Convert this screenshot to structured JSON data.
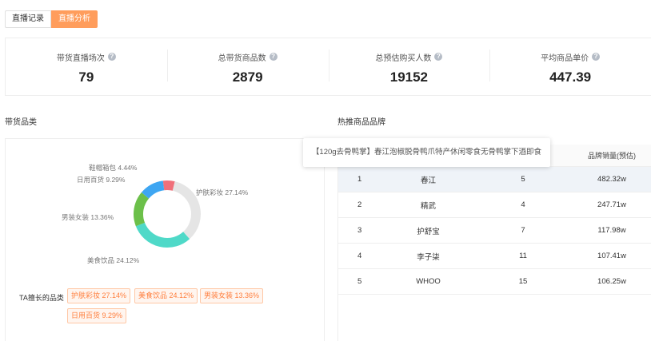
{
  "tabs": [
    {
      "label": "直播记录",
      "active": false
    },
    {
      "label": "直播分析",
      "active": true
    }
  ],
  "stats": [
    {
      "label": "带货直播场次",
      "value": "79"
    },
    {
      "label": "总带货商品数",
      "value": "2879"
    },
    {
      "label": "总预估购买人数",
      "value": "19152"
    },
    {
      "label": "平均商品单价",
      "value": "447.39"
    }
  ],
  "category_section": {
    "title": "带货品类"
  },
  "brand_section": {
    "title": "热推商品品牌"
  },
  "chart_data": {
    "type": "pie",
    "donut": true,
    "title": "",
    "slices": [
      {
        "label": "护肤彩妆 27.14%",
        "value": 27.14,
        "color": "#e5e5e5"
      },
      {
        "label": "美食饮品 24.12%",
        "value": 24.12,
        "color": "#4fd9c8"
      },
      {
        "label": "男装女装 13.36%",
        "value": 13.36,
        "color": "#6cc04a"
      },
      {
        "label": "日用百货 9.29%",
        "value": 9.29,
        "color": "#3ea6f2"
      },
      {
        "label": "鞋帽箱包 4.44%",
        "value": 4.44,
        "color": "#f0707a"
      }
    ]
  },
  "ta": {
    "title": "TA擅长的品类",
    "tags": [
      "护肤彩妆 27.14%",
      "美食饮品 24.12%",
      "男装女装 13.36%",
      "日用百货 9.29%"
    ]
  },
  "tooltip": "【120g去骨鸭掌】春江泡椒脱骨鸭爪特产休闲零食无骨鸭掌下酒即食",
  "brand_table": {
    "header_sales": "品牌销量(预估)",
    "rows": [
      {
        "rank": "1",
        "brand": "春江",
        "count": "5",
        "sales": "482.32w"
      },
      {
        "rank": "2",
        "brand": "精武",
        "count": "4",
        "sales": "247.71w"
      },
      {
        "rank": "3",
        "brand": "护舒宝",
        "count": "7",
        "sales": "117.98w"
      },
      {
        "rank": "4",
        "brand": "李子柒",
        "count": "11",
        "sales": "107.41w"
      },
      {
        "rank": "5",
        "brand": "WHOO",
        "count": "15",
        "sales": "106.25w"
      }
    ]
  }
}
